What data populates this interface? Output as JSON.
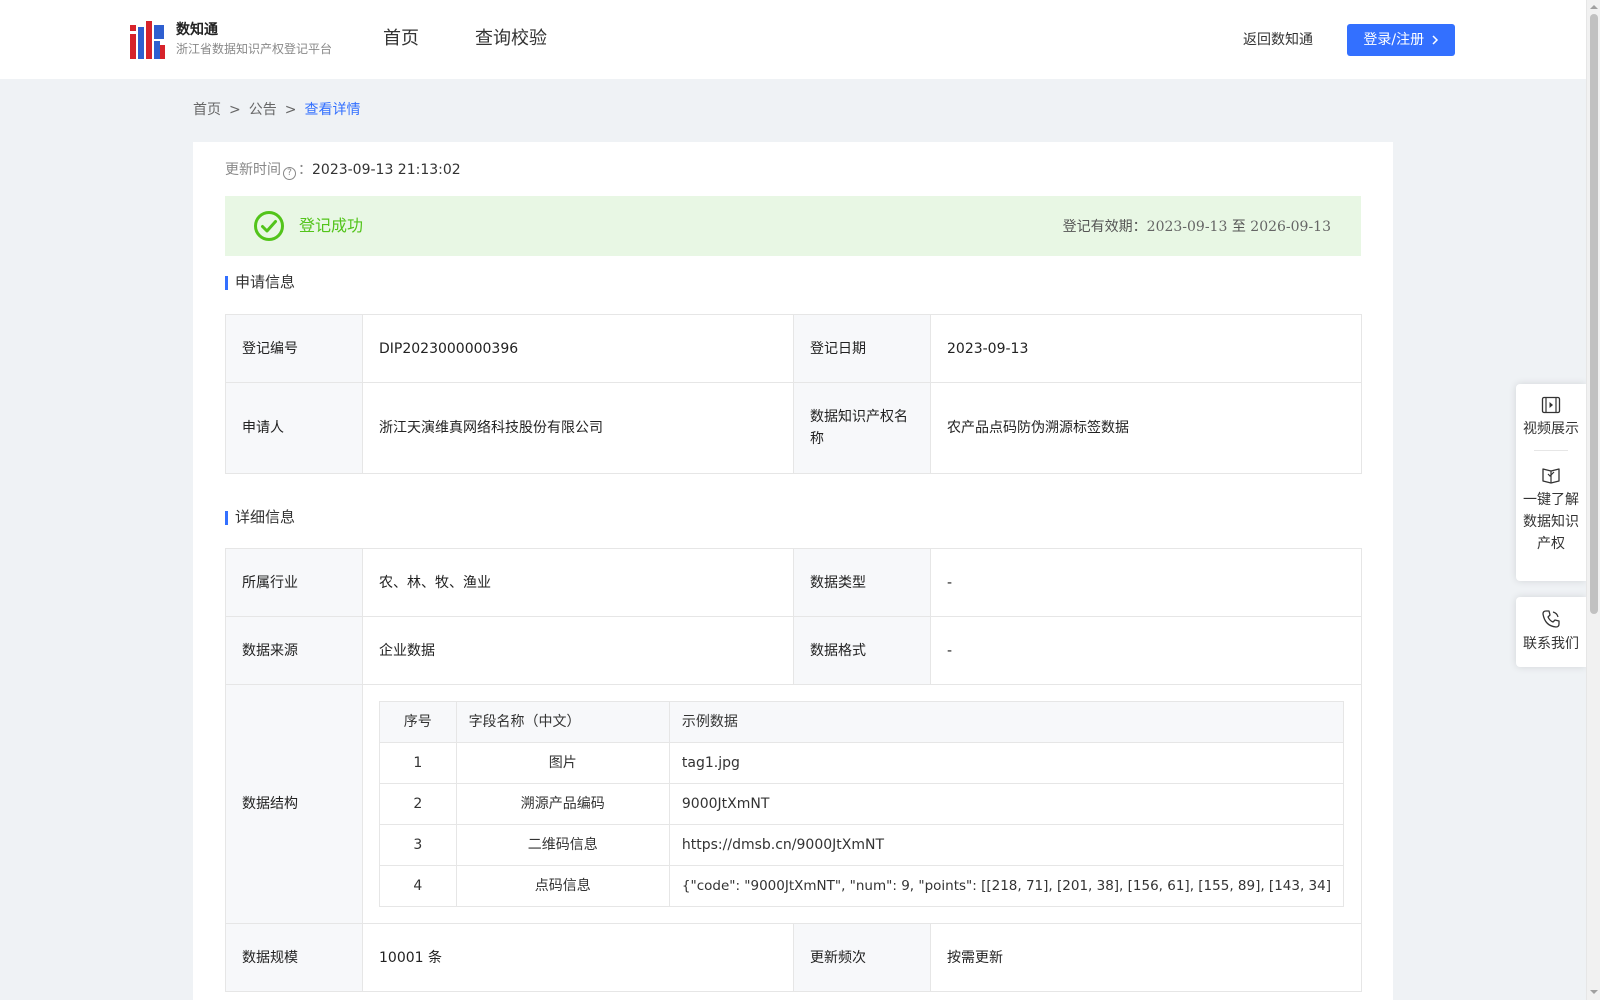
{
  "header": {
    "logo_title": "数知通",
    "logo_subtitle": "浙江省数据知识产权登记平台",
    "nav": [
      "首页",
      "查询校验"
    ],
    "back_link": "返回数知通",
    "login_button": "登录/注册"
  },
  "breadcrumb": {
    "items": [
      "首页",
      "公告"
    ],
    "separator": ">",
    "current": "查看详情"
  },
  "update": {
    "label": "更新时间",
    "colon": "：",
    "value": "2023-09-13 21:13:02"
  },
  "status": {
    "text": "登记成功",
    "validity_label": "登记有效期：",
    "validity_start": "2023-09-13",
    "validity_to": "至",
    "validity_end": "2026-09-13",
    "color": "#52c41a"
  },
  "application": {
    "section_title": "申请信息",
    "rows": [
      [
        "登记编号",
        "DIP2023000000396",
        "登记日期",
        "2023-09-13"
      ],
      [
        "申请人",
        "浙江天演维真网络科技股份有限公司",
        "数据知识产权名称",
        "农产品点码防伪溯源标签数据"
      ]
    ]
  },
  "details": {
    "section_title": "详细信息",
    "rows": [
      [
        "所属行业",
        "农、林、牧、渔业",
        "数据类型",
        "-"
      ],
      [
        "数据来源",
        "企业数据",
        "数据格式",
        "-"
      ]
    ],
    "structure_label": "数据结构",
    "structure": {
      "headers": [
        "序号",
        "字段名称（中文）",
        "示例数据"
      ],
      "rows": [
        [
          "1",
          "图片",
          "tag1.jpg"
        ],
        [
          "2",
          "溯源产品编码",
          "9000JtXmNT"
        ],
        [
          "3",
          "二维码信息",
          "https://dmsb.cn/9000JtXmNT"
        ],
        [
          "4",
          "点码信息",
          "{\"code\": \"9000JtXmNT\", \"num\": 9, \"points\": [[218, 71], [201, 38], [156, 61], [155, 89], [143, 34]"
        ]
      ]
    },
    "last_row": [
      "数据规模",
      "10001 条",
      "更新频次",
      "按需更新"
    ]
  },
  "float_menu": {
    "video": "视频展示",
    "learn_lines": [
      "一键了解",
      "数据知识",
      "产权"
    ],
    "contact": "联系我们"
  },
  "colors": {
    "accent": "#3370ff",
    "success_bg": "#e8f7e4",
    "page_bg": "#eff2f5"
  }
}
